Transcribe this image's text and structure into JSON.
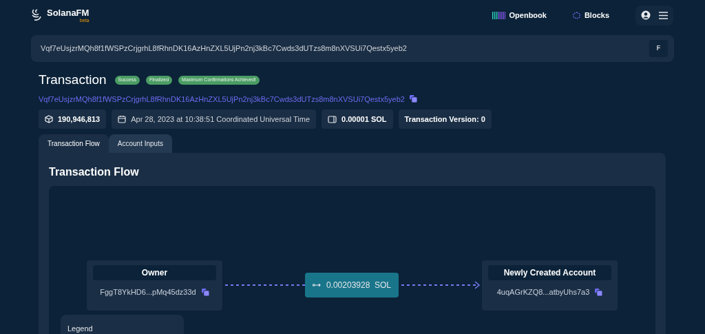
{
  "header": {
    "brand": "SolanaFM",
    "brand_tag": "beta",
    "nav": [
      {
        "label": "Openbook"
      },
      {
        "label": "Blocks"
      }
    ]
  },
  "search": {
    "value": "Vqf7eUsjzrMQh8f1fWSPzCrjgrhL8fRhnDK16AzHnZXL5UjPn2nj3kBc7Cwds3dUTzs8m8nXVSUi7Qestx5yeb2",
    "shortcut": "F"
  },
  "transaction": {
    "title": "Transaction",
    "badges": [
      "Success",
      "Finalized",
      "Maximum Confirmations Achieved!"
    ],
    "signature": "Vqf7eUsjzrMQh8f1fWSPzCrjgrhL8fRhnDK16AzHnZXL5UjPn2nj3kBc7Cwds3dUTzs8m8nXVSUi7Qestx5yeb2",
    "chips": [
      {
        "kind": "block",
        "text": "190,946,813"
      },
      {
        "kind": "time",
        "text": "Apr 28, 2023 at 10:38:51 Coordinated Universal Time"
      },
      {
        "kind": "fee",
        "text": "0.00001 SOL"
      },
      {
        "kind": "version",
        "text": "Transaction Version: 0"
      }
    ]
  },
  "tabs": [
    {
      "label": "Transaction Flow",
      "selected": true
    },
    {
      "label": "Account Inputs",
      "selected": false
    }
  ],
  "flow": {
    "title": "Transaction Flow",
    "source": {
      "label": "Owner",
      "address": "FggT8YkHD6...pMq45dz33d"
    },
    "transfer": {
      "amount": "0.00203928",
      "unit": "SOL"
    },
    "target": {
      "label": "Newly Created Account",
      "address": "4uqAGrKZQ8...atbyUhs7a3"
    },
    "legend": {
      "title": "Legend"
    }
  }
}
